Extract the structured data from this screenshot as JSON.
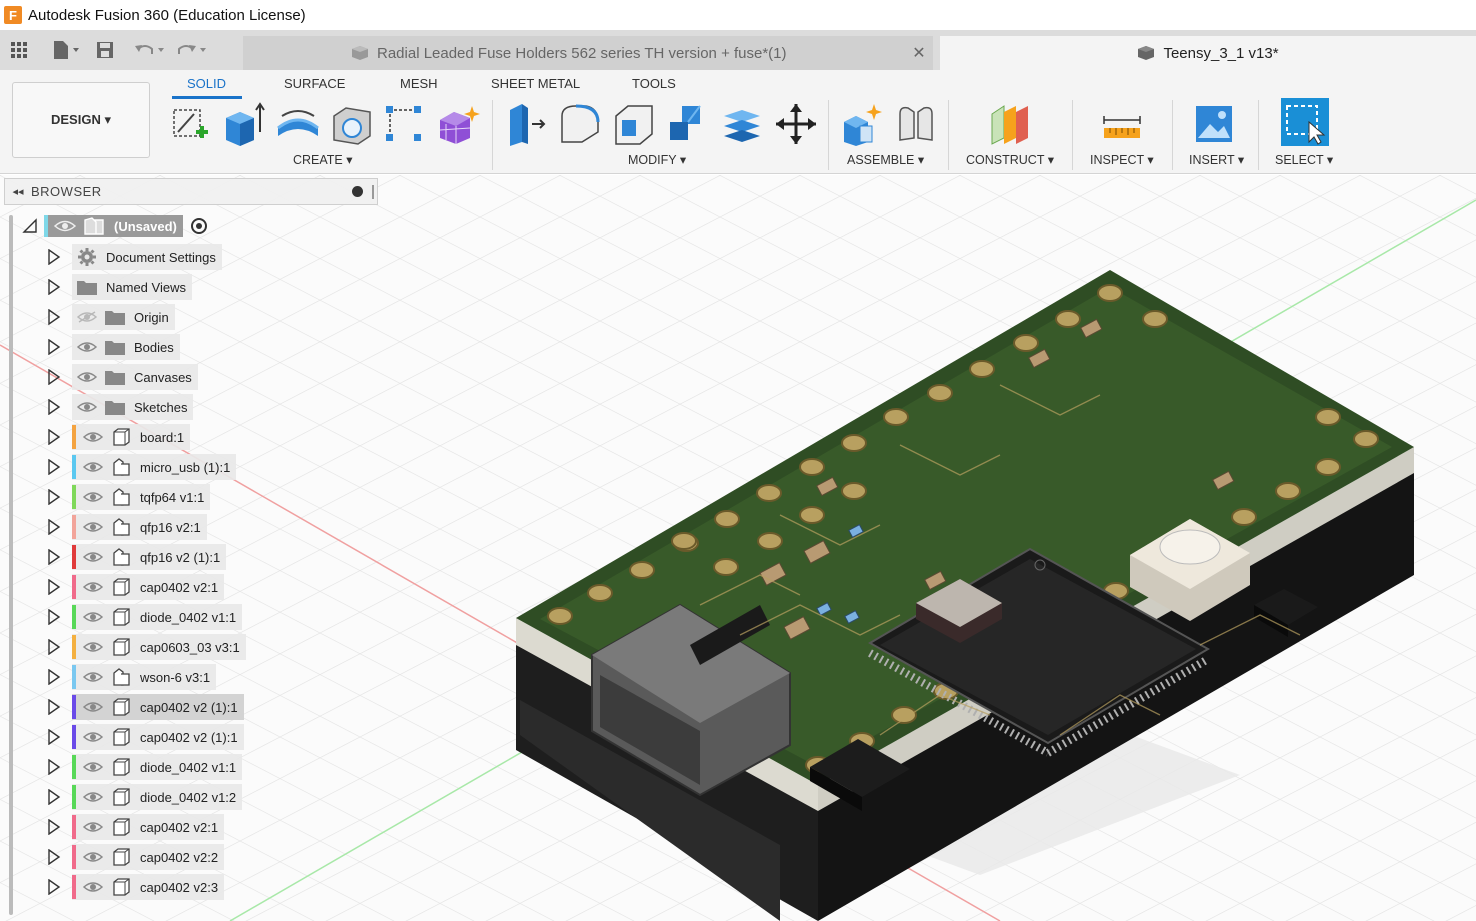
{
  "titlebar": {
    "logo_letter": "F",
    "title": "Autodesk Fusion 360 (Education License)"
  },
  "tabs": {
    "inactive_title": "Radial Leaded Fuse Holders 562 series TH version + fuse*(1)",
    "active_title": "Teensy_3_1 v13*",
    "close_glyph": "✕"
  },
  "toolbar": {
    "workspace_label": "DESIGN ▾",
    "workspace_tabs": [
      "SOLID",
      "SURFACE",
      "MESH",
      "SHEET METAL",
      "TOOLS"
    ],
    "groups": {
      "create": "CREATE ▾",
      "modify": "MODIFY ▾",
      "assemble": "ASSEMBLE ▾",
      "construct": "CONSTRUCT ▾",
      "inspect": "INSPECT ▾",
      "insert": "INSERT ▾",
      "select": "SELECT ▾"
    }
  },
  "browser": {
    "title": "BROWSER",
    "root_label": "(Unsaved)",
    "items": [
      {
        "label": "Document Settings",
        "icon": "gear-icon",
        "eye": "none",
        "color": ""
      },
      {
        "label": "Named Views",
        "icon": "folder-icon",
        "eye": "none",
        "color": ""
      },
      {
        "label": "Origin",
        "icon": "folder-icon",
        "eye": "hidden",
        "color": ""
      },
      {
        "label": "Bodies",
        "icon": "folder-icon",
        "eye": "visible",
        "color": ""
      },
      {
        "label": "Canvases",
        "icon": "folder-icon",
        "eye": "visible",
        "color": ""
      },
      {
        "label": "Sketches",
        "icon": "folder-icon",
        "eye": "visible",
        "color": ""
      },
      {
        "label": "board:1",
        "icon": "component-icon",
        "eye": "visible",
        "color": "#f4a340"
      },
      {
        "label": "micro_usb (1):1",
        "icon": "linked-component-icon",
        "eye": "visible",
        "color": "#5bc8f0"
      },
      {
        "label": "tqfp64 v1:1",
        "icon": "linked-component-icon",
        "eye": "visible",
        "color": "#7fd85a"
      },
      {
        "label": "qfp16 v2:1",
        "icon": "linked-component-icon",
        "eye": "visible",
        "color": "#f2a49a"
      },
      {
        "label": "qfp16 v2 (1):1",
        "icon": "linked-component-icon",
        "eye": "visible",
        "color": "#e03a3a"
      },
      {
        "label": "cap0402 v2:1",
        "icon": "component-icon",
        "eye": "visible",
        "color": "#f06a8a"
      },
      {
        "label": "diode_0402 v1:1",
        "icon": "component-icon",
        "eye": "visible",
        "color": "#58d858"
      },
      {
        "label": "cap0603_03 v3:1",
        "icon": "component-icon",
        "eye": "visible",
        "color": "#f4b040"
      },
      {
        "label": "wson-6 v3:1",
        "icon": "linked-component-icon",
        "eye": "visible",
        "color": "#7ac8f0"
      },
      {
        "label": "cap0402 v2 (1):1",
        "icon": "component-icon",
        "eye": "visible",
        "color": "#6a4ae8",
        "selected": true
      },
      {
        "label": "cap0402 v2 (1):1",
        "icon": "component-icon",
        "eye": "visible",
        "color": "#6a4ae8"
      },
      {
        "label": "diode_0402 v1:1",
        "icon": "component-icon",
        "eye": "visible",
        "color": "#58d858"
      },
      {
        "label": "diode_0402 v1:2",
        "icon": "component-icon",
        "eye": "visible",
        "color": "#58d858"
      },
      {
        "label": "cap0402 v2:1",
        "icon": "component-icon",
        "eye": "visible",
        "color": "#f06a8a"
      },
      {
        "label": "cap0402 v2:2",
        "icon": "component-icon",
        "eye": "visible",
        "color": "#f06a8a"
      },
      {
        "label": "cap0402 v2:3",
        "icon": "component-icon",
        "eye": "visible",
        "color": "#f06a8a"
      }
    ]
  }
}
